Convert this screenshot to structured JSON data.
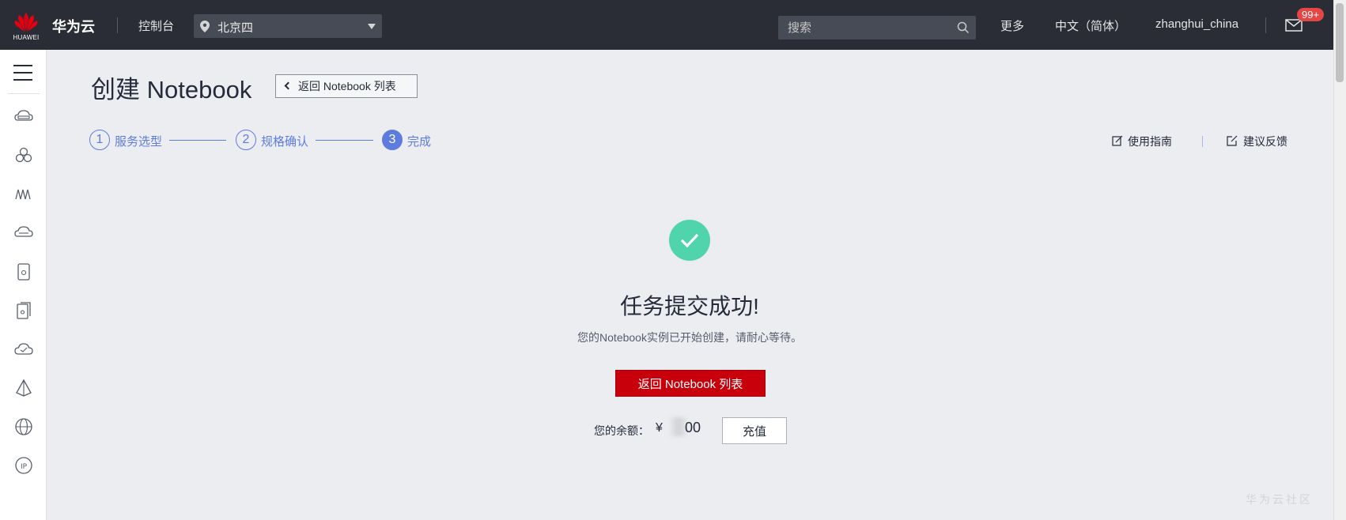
{
  "header": {
    "logo_text": "HUAWEI",
    "brand": "华为云",
    "console": "控制台",
    "region": "北京四",
    "search_placeholder": "搜索",
    "more": "更多",
    "language": "中文（简体）",
    "username": "zhanghui_china",
    "mail_badge": "99+"
  },
  "sidebar": {
    "icons": [
      "cloud-server-icon",
      "cluster-icon",
      "function-icon",
      "storage-icon",
      "phone-icon",
      "database-icon",
      "cloud-icon",
      "network-icon",
      "globe-icon",
      "ip-icon"
    ]
  },
  "page": {
    "title": "创建 Notebook",
    "back_link": "返回 Notebook 列表",
    "steps": [
      {
        "num": "1",
        "label": "服务选型"
      },
      {
        "num": "2",
        "label": "规格确认"
      },
      {
        "num": "3",
        "label": "完成"
      }
    ],
    "guide": "使用指南",
    "feedback": "建议反馈"
  },
  "result": {
    "title": "任务提交成功!",
    "description": "您的Notebook实例已开始创建，请耐心等待。",
    "primary_button": "返回 Notebook 列表",
    "balance_label": "您的余额：",
    "currency": "¥",
    "balance_visible": "00",
    "recharge_button": "充值"
  },
  "watermark": "华为云社区",
  "colors": {
    "topbar": "#2a2d35",
    "accent": "#5e7ce0",
    "primary": "#c7000b",
    "success": "#50d4ab"
  }
}
